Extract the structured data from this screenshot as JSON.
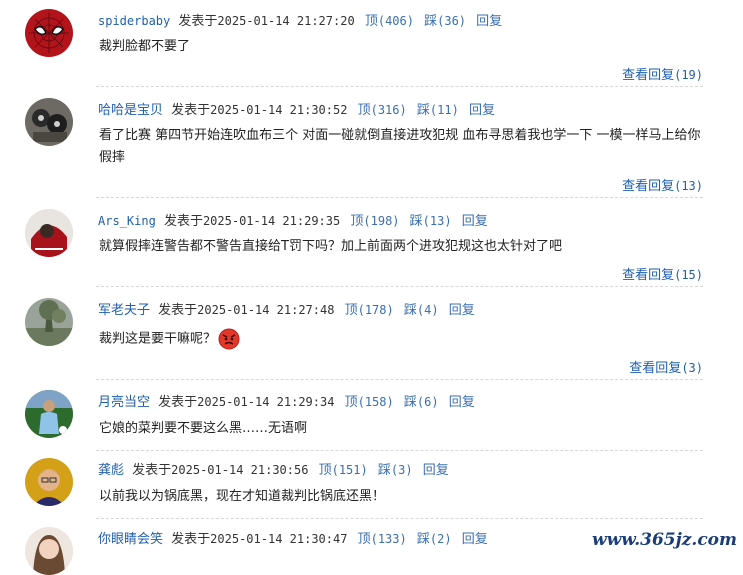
{
  "comments": [
    {
      "user": "spiderbaby",
      "posted": "发表于",
      "time": "2025-01-14  21:27:20",
      "up_label": "顶",
      "up": "(406)",
      "down_label": "踩",
      "down": "(36)",
      "reply": "回复",
      "text": "裁判脸都不要了",
      "more_label": "查看回复",
      "more_count": "(19)",
      "avatar": "spiderman-avatar"
    },
    {
      "user": "哈哈是宝贝",
      "posted": "发表于",
      "time": "2025-01-14  21:30:52",
      "up_label": "顶",
      "up": "(316)",
      "down_label": "踩",
      "down": "(11)",
      "reply": "回复",
      "text": "看了比赛 第四节开始连吹血布三个 对面一碰就倒直接进攻犯规 血布寻思着我也学一下 一模一样马上给你假摔",
      "more_label": "查看回复",
      "more_count": "(13)",
      "avatar": "dark-photo-avatar"
    },
    {
      "user": "Ars_King",
      "posted": "发表于",
      "time": "2025-01-14  21:29:35",
      "up_label": "顶",
      "up": "(198)",
      "down_label": "踩",
      "down": "(13)",
      "reply": "回复",
      "text": "就算假摔连警告都不警告直接给T罚下吗？加上前面两个进攻犯规这也太针对了吧",
      "more_label": "查看回复",
      "more_count": "(15)",
      "avatar": "red-photo-avatar"
    },
    {
      "user": "军老夫子",
      "posted": "发表于",
      "time": "2025-01-14  21:27:48",
      "up_label": "顶",
      "up": "(178)",
      "down_label": "踩",
      "down": "(4)",
      "reply": "回复",
      "text": "裁判这是要干嘛呢？",
      "more_label": "查看回复",
      "more_count": "(3)",
      "avatar": "landscape-avatar",
      "emoji": "angry-face-icon"
    },
    {
      "user": "月亮当空",
      "posted": "发表于",
      "time": "2025-01-14  21:29:34",
      "up_label": "顶",
      "up": "(158)",
      "down_label": "踩",
      "down": "(6)",
      "reply": "回复",
      "text": "它娘的菜判要不要这么黑……无语啊",
      "avatar": "soccer-player-avatar"
    },
    {
      "user": "龚彪",
      "posted": "发表于",
      "time": "2025-01-14  21:30:56",
      "up_label": "顶",
      "up": "(151)",
      "down_label": "踩",
      "down": "(3)",
      "reply": "回复",
      "text": "以前我以为锅底黑，现在才知道裁判比锅底还黑！",
      "avatar": "man-portrait-avatar"
    },
    {
      "user": "你眼睛会笑",
      "posted": "发表于",
      "time": "2025-01-14  21:30:47",
      "up_label": "顶",
      "up": "(133)",
      "down_label": "踩",
      "down": "(2)",
      "reply": "回复",
      "text": "",
      "avatar": "woman-portrait-avatar"
    }
  ],
  "watermark": "www.365jz.com",
  "colors": {
    "link": "#1f5fae",
    "action": "#3a6fb0",
    "text": "#222222"
  }
}
